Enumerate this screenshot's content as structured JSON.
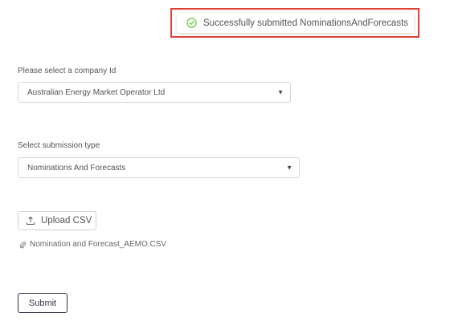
{
  "toast": {
    "message": "Successfully submitted NominationsAndForecasts",
    "icon": "check-circle-icon",
    "icon_color": "#52c41a",
    "highlight_color": "#e0403a"
  },
  "company": {
    "label": "Please select a company Id",
    "value": "Australian Energy Market Operator Ltd",
    "caret": "▼"
  },
  "submission_type": {
    "label": "Select submission type",
    "value": "Nominations And Forecasts",
    "caret": "▼"
  },
  "upload": {
    "label": "Upload CSV",
    "icon": "upload-icon"
  },
  "file": {
    "name": "Nomination and Forecast_AEMO.CSV",
    "icon": "paperclip-icon"
  },
  "submit": {
    "label": "Submit",
    "color": "#3a2e4a"
  }
}
